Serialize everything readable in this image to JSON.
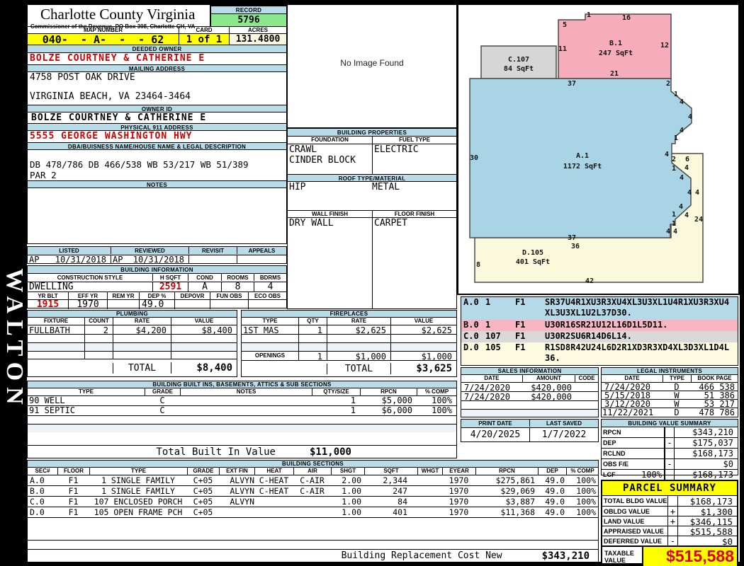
{
  "title": {
    "county": "Charlotte County Virginia",
    "commissioner": "Commissioner of the Revenue, PO Box 308, Charlotte CH, VA",
    "record_label": "RECORD",
    "record_number": "5796",
    "map_number_label": "MAP NUMBER",
    "map_number": "040-  - A-  -  - 62",
    "card_label": "CARD",
    "card": "1 of 1",
    "acres_label": "ACRES",
    "acres": "131.4800"
  },
  "watermark": "WALTON",
  "owner": {
    "deeded_owner_label": "DEEDED OWNER",
    "deeded_owner": "BOLZE COURTNEY & CATHERINE E",
    "mailing_label": "MAILING ADDRESS",
    "mailing_line1": "4758 POST OAK DRIVE",
    "mailing_line2": "VIRGINIA BEACH, VA 23464-3464",
    "owner_id_label": "OWNER ID",
    "owner_id": "BOLZE COURTNEY & CATHERINE E",
    "physical_label": "PHYSICAL 911 ADDRESS",
    "physical_address": "5555 GEORGE WASHINGTON HWY",
    "dba_label": "DBA/BUISNESS NAME/HOUSE NAME & LEGAL DESCRIPTION",
    "legal_line1": "DB 478/786 DB 466/538 WB 53/217 WB 51/389",
    "legal_line2": "PAR 2",
    "notes_label": "NOTES"
  },
  "image_panel": {
    "no_image_text": "No Image Found"
  },
  "building_properties": {
    "title": "BUILDING PROPERTIES",
    "foundation_label": "FOUNDATION",
    "fuel_label": "FUEL TYPE",
    "foundation_line1": "CRAWL",
    "foundation_line2": "CINDER BLOCK",
    "fuel": "ELECTRIC",
    "roof_label": "ROOF TYPE/MATERIAL",
    "roof_type": "HIP",
    "roof_material": "METAL",
    "wall_label": "WALL FINISH",
    "floor_label": "FLOOR FINISH",
    "wall_finish": "DRY WALL",
    "floor_finish": "CARPET"
  },
  "visits": {
    "listed_label": "LISTED",
    "reviewed_label": "REVIEWED",
    "revisit_label": "REVISIT",
    "appeals_label": "APPEALS",
    "listed_code": "AP",
    "listed_date": "10/31/2018",
    "reviewed_code": "AP",
    "reviewed_date": "10/31/2018",
    "revisit": "",
    "appeals": ""
  },
  "building_info": {
    "title": "BUILDING INFORMATION",
    "style_label": "CONSTRUCTION STYLE",
    "hsqft_label": "H SQFT",
    "cond_label": "COND",
    "rooms_label": "ROOMS",
    "bdrms_label": "BDRMS",
    "style": "DWELLING",
    "hsqft": "2591",
    "cond": "A",
    "rooms": "8",
    "bdrms": "4",
    "yrblt_label": "YR BLT",
    "effyr_label": "EFF YR",
    "remyr_label": "REM YR",
    "dep_label": "DEP %",
    "depovr_label": "DEPOVR",
    "funobs_label": "FUN OBS",
    "ecoobs_label": "ECO OBS",
    "yrblt": "1915",
    "effyr": "1970",
    "remyr": "",
    "dep": "49.0",
    "depovr": "",
    "funobs": "",
    "ecoobs": ""
  },
  "plumbing": {
    "title": "PLUMBING",
    "headers": [
      "FIXTURE",
      "COUNT",
      "RATE",
      "VALUE"
    ],
    "row": {
      "fixture": "FULLBATH",
      "count": "2",
      "rate": "$4,200",
      "value": "$8,400"
    },
    "total_label": "TOTAL",
    "total": "$8,400"
  },
  "fireplaces": {
    "title": "FIREPLACES",
    "headers": [
      "TYPE",
      "QTY",
      "RATE",
      "VALUE"
    ],
    "row": {
      "type": "1ST MAS",
      "qty": "1",
      "rate": "$2,625",
      "value": "$2,625"
    },
    "openings_label": "OPENINGS",
    "openings": {
      "qty": "1",
      "rate": "$1,000",
      "value": "$1,000"
    },
    "total_label": "TOTAL",
    "total": "$3,625"
  },
  "built_ins": {
    "title": "BUILDING BUILT INS, BASEMENTS, ATTICS & SUB SECTIONS",
    "headers": [
      "TYPE",
      "GRADE",
      "NOTES",
      "QTY/SIZE",
      "RPCN",
      "% COMP"
    ],
    "rows": [
      {
        "type": "90 WELL",
        "grade": "C",
        "notes": "",
        "qty": "1",
        "rpcn": "$5,000",
        "comp": "100%"
      },
      {
        "type": "91 SEPTIC",
        "grade": "C",
        "notes": "",
        "qty": "1",
        "rpcn": "$6,000",
        "comp": "100%"
      }
    ],
    "total_label": "Total Built In Value",
    "total": "$11,000"
  },
  "building_sections": {
    "title": "BUILDING SECTIONS",
    "headers": [
      "SEC#",
      "FLOOR",
      "TYPE",
      "GRADE",
      "EXT FIN",
      "HEAT",
      "AIR",
      "SHGT",
      "SQFT",
      "WHGT",
      "EYEAR",
      "RPCN",
      "DEP",
      "% COMP"
    ],
    "rows": [
      [
        "A.0",
        "F1",
        "1 SINGLE FAMILY",
        "C+05",
        "ALVYN",
        "C-HEAT",
        "C-AIR",
        "2.00",
        "2,344",
        "",
        "1970",
        "$275,861",
        "49.0",
        "100%"
      ],
      [
        "B.0",
        "F1",
        "1 SINGLE FAMILY",
        "C+05",
        "ALVYN",
        "C-HEAT",
        "C-AIR",
        "1.00",
        "247",
        "",
        "1970",
        "$29,069",
        "49.0",
        "100%"
      ],
      [
        "C.0",
        "F1",
        "107 ENCLOSED PORCH",
        "C+05",
        "ALVYN",
        "",
        "",
        "1.00",
        "84",
        "",
        "1970",
        "$3,887",
        "49.0",
        "100%"
      ],
      [
        "D.0",
        "F1",
        "105 OPEN FRAME PCH",
        "C+05",
        "",
        "",
        "",
        "1.00",
        "401",
        "",
        "1970",
        "$11,368",
        "49.0",
        "100%"
      ]
    ],
    "footer_label": "Building Replacement Cost New",
    "footer_value": "$343,210"
  },
  "sketch": {
    "dims": [
      "5",
      "1",
      "16",
      "12",
      "11",
      "21",
      "B.1",
      "247 SqFt",
      "C.107",
      "84 SqFt",
      "37",
      "2",
      "1",
      "4",
      "4",
      "4",
      "1",
      "30",
      "A.1",
      "1172 SqFt",
      "4",
      "2",
      "6",
      "1",
      "4",
      "4",
      "4",
      "4",
      "4",
      "1",
      "4",
      "24",
      "1",
      "4",
      "4",
      "37",
      "36",
      "D.105",
      "401 SqFt",
      "8",
      "42"
    ],
    "codes": [
      {
        "sec": "A.0",
        "type": "1",
        "floor": "F1",
        "code": "SR37U4R1XU3R3XU4XL3U3XL1U4R1XU3R3XU4XL3U3XL1U2L37D30."
      },
      {
        "sec": "B.0",
        "type": "1",
        "floor": "F1",
        "code": "U30R16SR21U12L16D1L5D11."
      },
      {
        "sec": "C.0",
        "type": "107",
        "floor": "F1",
        "code": "U30R2SU6R14D6L14."
      },
      {
        "sec": "D.0",
        "type": "105",
        "floor": "F1",
        "code": "R1SD8R42U24L6D2R1XD3R3XD4XL3D3XL1D4L36."
      }
    ]
  },
  "sales": {
    "title": "SALES INFORMATION",
    "headers": [
      "DATE",
      "AMOUNT",
      "CODE"
    ],
    "rows": [
      {
        "date": "7/24/2020",
        "amount": "$420,000",
        "code": ""
      },
      {
        "date": "7/24/2020",
        "amount": "$420,000",
        "code": ""
      }
    ]
  },
  "legal": {
    "title": "LEGAL INSTRUMENTS",
    "headers": [
      "DATE",
      "TYPE",
      "BOOK PAGE"
    ],
    "rows": [
      {
        "date": "7/24/2020",
        "type": "D",
        "book_page": "466 538"
      },
      {
        "date": "5/15/2018",
        "type": "W",
        "book_page": "51 386"
      },
      {
        "date": "3/12/2020",
        "type": "W",
        "book_page": "53 217"
      },
      {
        "date": "11/22/2021",
        "type": "D",
        "book_page": "478 786"
      }
    ]
  },
  "print_info": {
    "print_label": "PRINT DATE",
    "print_date": "4/20/2025",
    "saved_label": "LAST SAVED",
    "last_saved": "1/7/2022"
  },
  "value_summary": {
    "title": "BUILDING VALUE SUMMARY",
    "rows": [
      {
        "label": "RPCN",
        "pct": "",
        "op": "",
        "value": "$343,210"
      },
      {
        "label": "DEP",
        "pct": "",
        "op": "-",
        "value": "$175,037"
      },
      {
        "label": "RCLND",
        "pct": "",
        "op": "",
        "value": "$168,173"
      },
      {
        "label": "OBS F/E",
        "pct": "",
        "op": "-",
        "value": "$0"
      },
      {
        "label": "LCF",
        "pct": "100%",
        "op": "",
        "value": "$168,173"
      }
    ]
  },
  "parcel_summary": {
    "title": "PARCEL SUMMARY",
    "rows": [
      {
        "label": "TOTAL BLDG VALUE",
        "op": "",
        "value": "$168,173"
      },
      {
        "label": "OBLDG VALUE",
        "op": "+",
        "value": "$1,300"
      },
      {
        "label": "LAND VALUE",
        "op": "+",
        "value": "$346,115"
      },
      {
        "label": "APPRAISED VALUE",
        "op": "",
        "value": "$515,588"
      },
      {
        "label": "DEFERRED VALUE",
        "op": "-",
        "value": "$0"
      }
    ],
    "taxable_label": "TAXABLE VALUE",
    "taxable_value": "$515,588"
  },
  "colors": {
    "band_blue": "#B8DDE9",
    "highlight_yellow": "#FFFF00",
    "record_green": "#8CE68C",
    "acres_ivory": "#FAF7E0",
    "red_text": "#CC0000",
    "taxable_red": "#E00000",
    "sketch_pink": "#F7ACBC",
    "sketch_blue": "#A9D4E6",
    "sketch_grey": "#D6D6D6",
    "sketch_yellow": "#FBF9DC"
  }
}
